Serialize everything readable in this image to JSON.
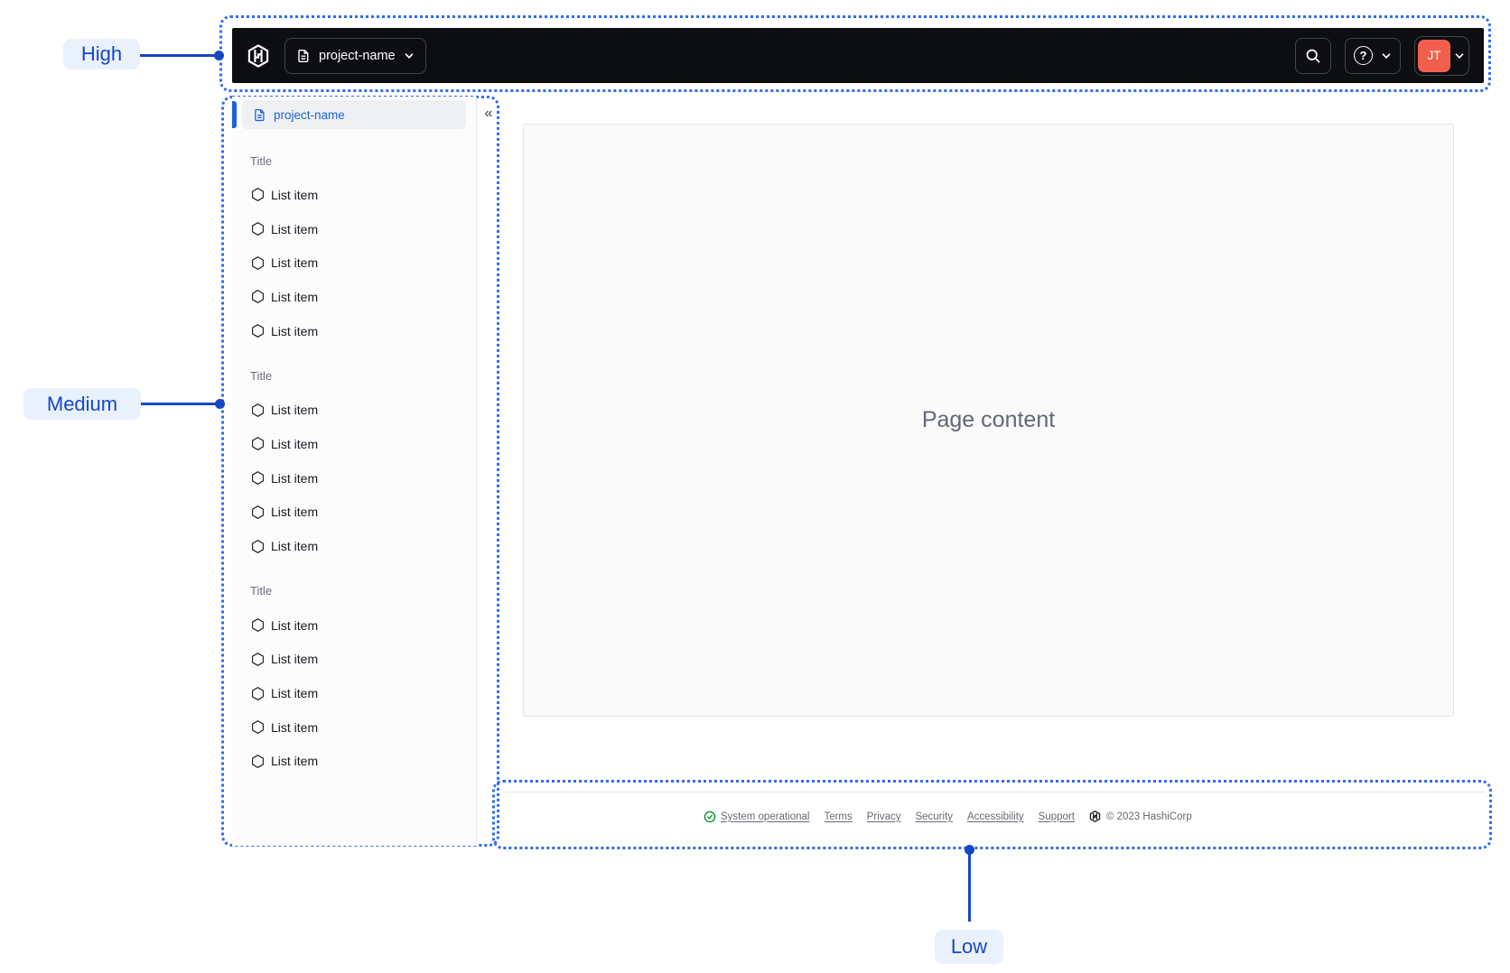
{
  "annotations": {
    "high": "High",
    "medium": "Medium",
    "low": "Low"
  },
  "navbar": {
    "project_selector_label": "project-name"
  },
  "account": {
    "initials": "JT"
  },
  "sidebar": {
    "active_item": "project-name",
    "collapse_icon": "«",
    "sections": [
      {
        "title": "Title",
        "items": [
          "List item",
          "List item",
          "List item",
          "List item",
          "List item"
        ]
      },
      {
        "title": "Title",
        "items": [
          "List item",
          "List item",
          "List item",
          "List item",
          "List item"
        ]
      },
      {
        "title": "Title",
        "items": [
          "List item",
          "List item",
          "List item",
          "List item",
          "List item"
        ]
      }
    ]
  },
  "main": {
    "placeholder": "Page content"
  },
  "footer": {
    "status": "System operational",
    "links": [
      "Terms",
      "Privacy",
      "Security",
      "Accessibility",
      "Support"
    ],
    "copyright": "© 2023 HashiCorp"
  },
  "colors": {
    "annotation_blue": "#1747c6",
    "dotted_border_blue": "#2f6cf2",
    "sidebar_active_blue": "#1c62da",
    "avatar_orange": "#f2604d",
    "status_green": "#008a22",
    "navbar_background": "#0d0e12"
  }
}
